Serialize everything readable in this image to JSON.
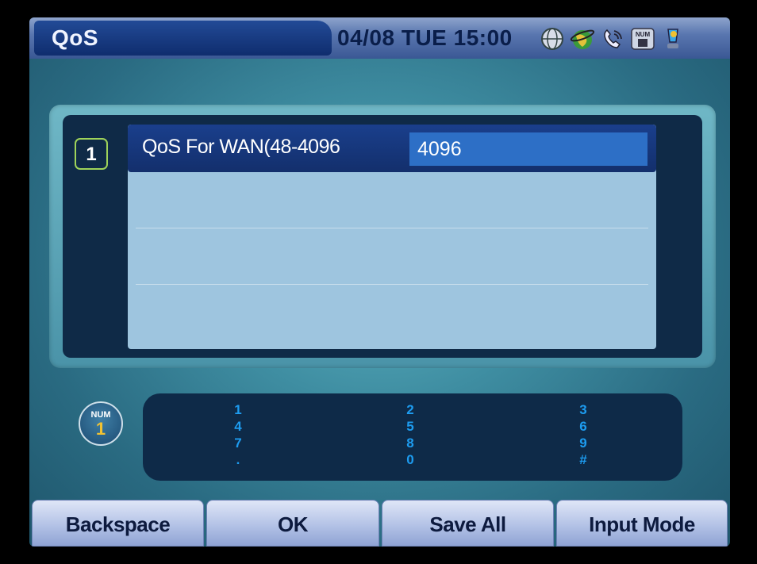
{
  "title": "QoS",
  "datetime": "04/08 TUE 15:00",
  "status_icons": [
    "network-globe-icon",
    "internet-globe-icon",
    "phone-ring-icon",
    "num-keypad-icon",
    "user-status-icon"
  ],
  "list": {
    "index": "1",
    "selected_row": {
      "label": "QoS For WAN(48-4096",
      "value": "4096"
    }
  },
  "input_mode": {
    "label": "NUM",
    "value": "1"
  },
  "keypad": {
    "columns": [
      [
        "1",
        "4",
        "7",
        "."
      ],
      [
        "2",
        "5",
        "8",
        "0"
      ],
      [
        "3",
        "6",
        "9",
        "#"
      ]
    ]
  },
  "softkeys": {
    "backspace": "Backspace",
    "ok": "OK",
    "save_all": "Save All",
    "input_mode": "Input Mode"
  },
  "colors": {
    "title_bar": "#3a5894",
    "selected_row": "#1a3f8c",
    "value_field": "#2d6fc6",
    "keypad_text": "#1d9cf0",
    "index_border": "#9fd35a"
  }
}
